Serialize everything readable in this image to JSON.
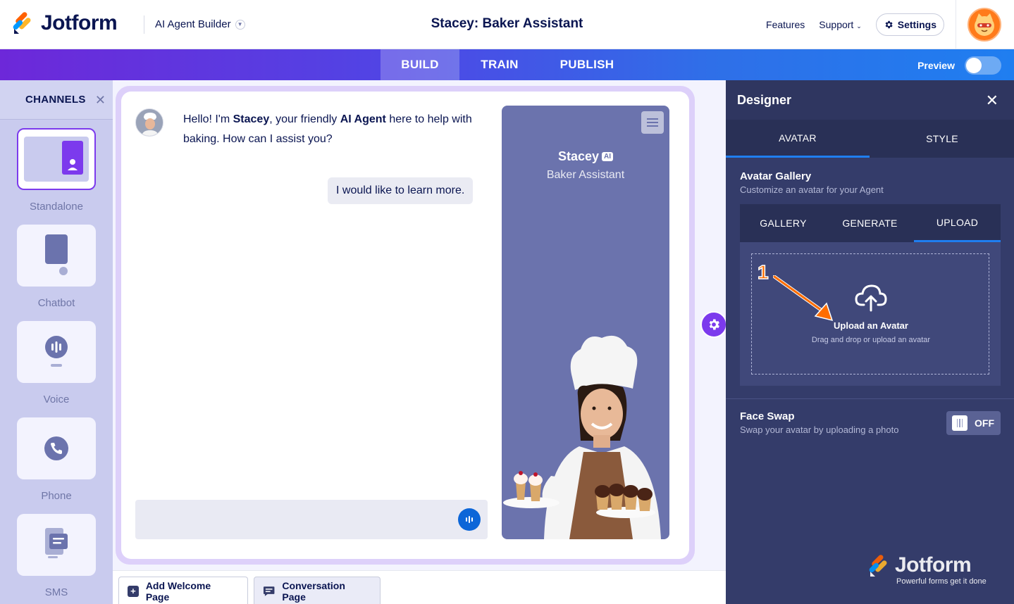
{
  "header": {
    "brand": "Jotform",
    "product": "AI Agent Builder",
    "title": "Stacey: Baker Assistant",
    "nav": {
      "features": "Features",
      "support": "Support",
      "settings": "Settings"
    }
  },
  "tabs": {
    "build": "BUILD",
    "train": "TRAIN",
    "publish": "PUBLISH",
    "active": "BUILD"
  },
  "preview_label": "Preview",
  "channels": {
    "title": "CHANNELS",
    "items": [
      {
        "label": "Standalone",
        "active": true
      },
      {
        "label": "Chatbot",
        "active": false
      },
      {
        "label": "Voice",
        "active": false
      },
      {
        "label": "Phone",
        "active": false
      },
      {
        "label": "SMS",
        "active": false
      }
    ]
  },
  "chat": {
    "bot_msg_pre": "Hello! I'm ",
    "bot_name": "Stacey",
    "bot_msg_mid": ", your friendly ",
    "bot_role_bold": "AI Agent",
    "bot_msg_post": " here to help with baking. How can I assist you?",
    "user_msg": "I would like to learn more."
  },
  "agent_card": {
    "name": "Stacey",
    "badge": "AI",
    "role": "Baker Assistant"
  },
  "bottom": {
    "welcome": "Add Welcome Page",
    "conversation": "Conversation Page"
  },
  "designer": {
    "title": "Designer",
    "tabs": {
      "avatar": "AVATAR",
      "style": "STYLE"
    },
    "gallery": {
      "title": "Avatar Gallery",
      "subtitle": "Customize an avatar for your Agent",
      "tabs": {
        "gallery": "GALLERY",
        "generate": "GENERATE",
        "upload": "UPLOAD"
      },
      "upload_title": "Upload an Avatar",
      "upload_sub": "Drag and drop or upload an avatar",
      "step": "1"
    },
    "face_swap": {
      "title": "Face Swap",
      "subtitle": "Swap your avatar by uploading a photo",
      "state": "OFF"
    },
    "watermark": {
      "brand": "Jotform",
      "tagline": "Powerful forms get it done"
    }
  },
  "colors": {
    "accent_purple": "#7c3aed",
    "accent_blue": "#1f7ef0",
    "panel": "#343c6a",
    "agent_card": "#6b73ad",
    "brand_navy": "#0a1551"
  }
}
